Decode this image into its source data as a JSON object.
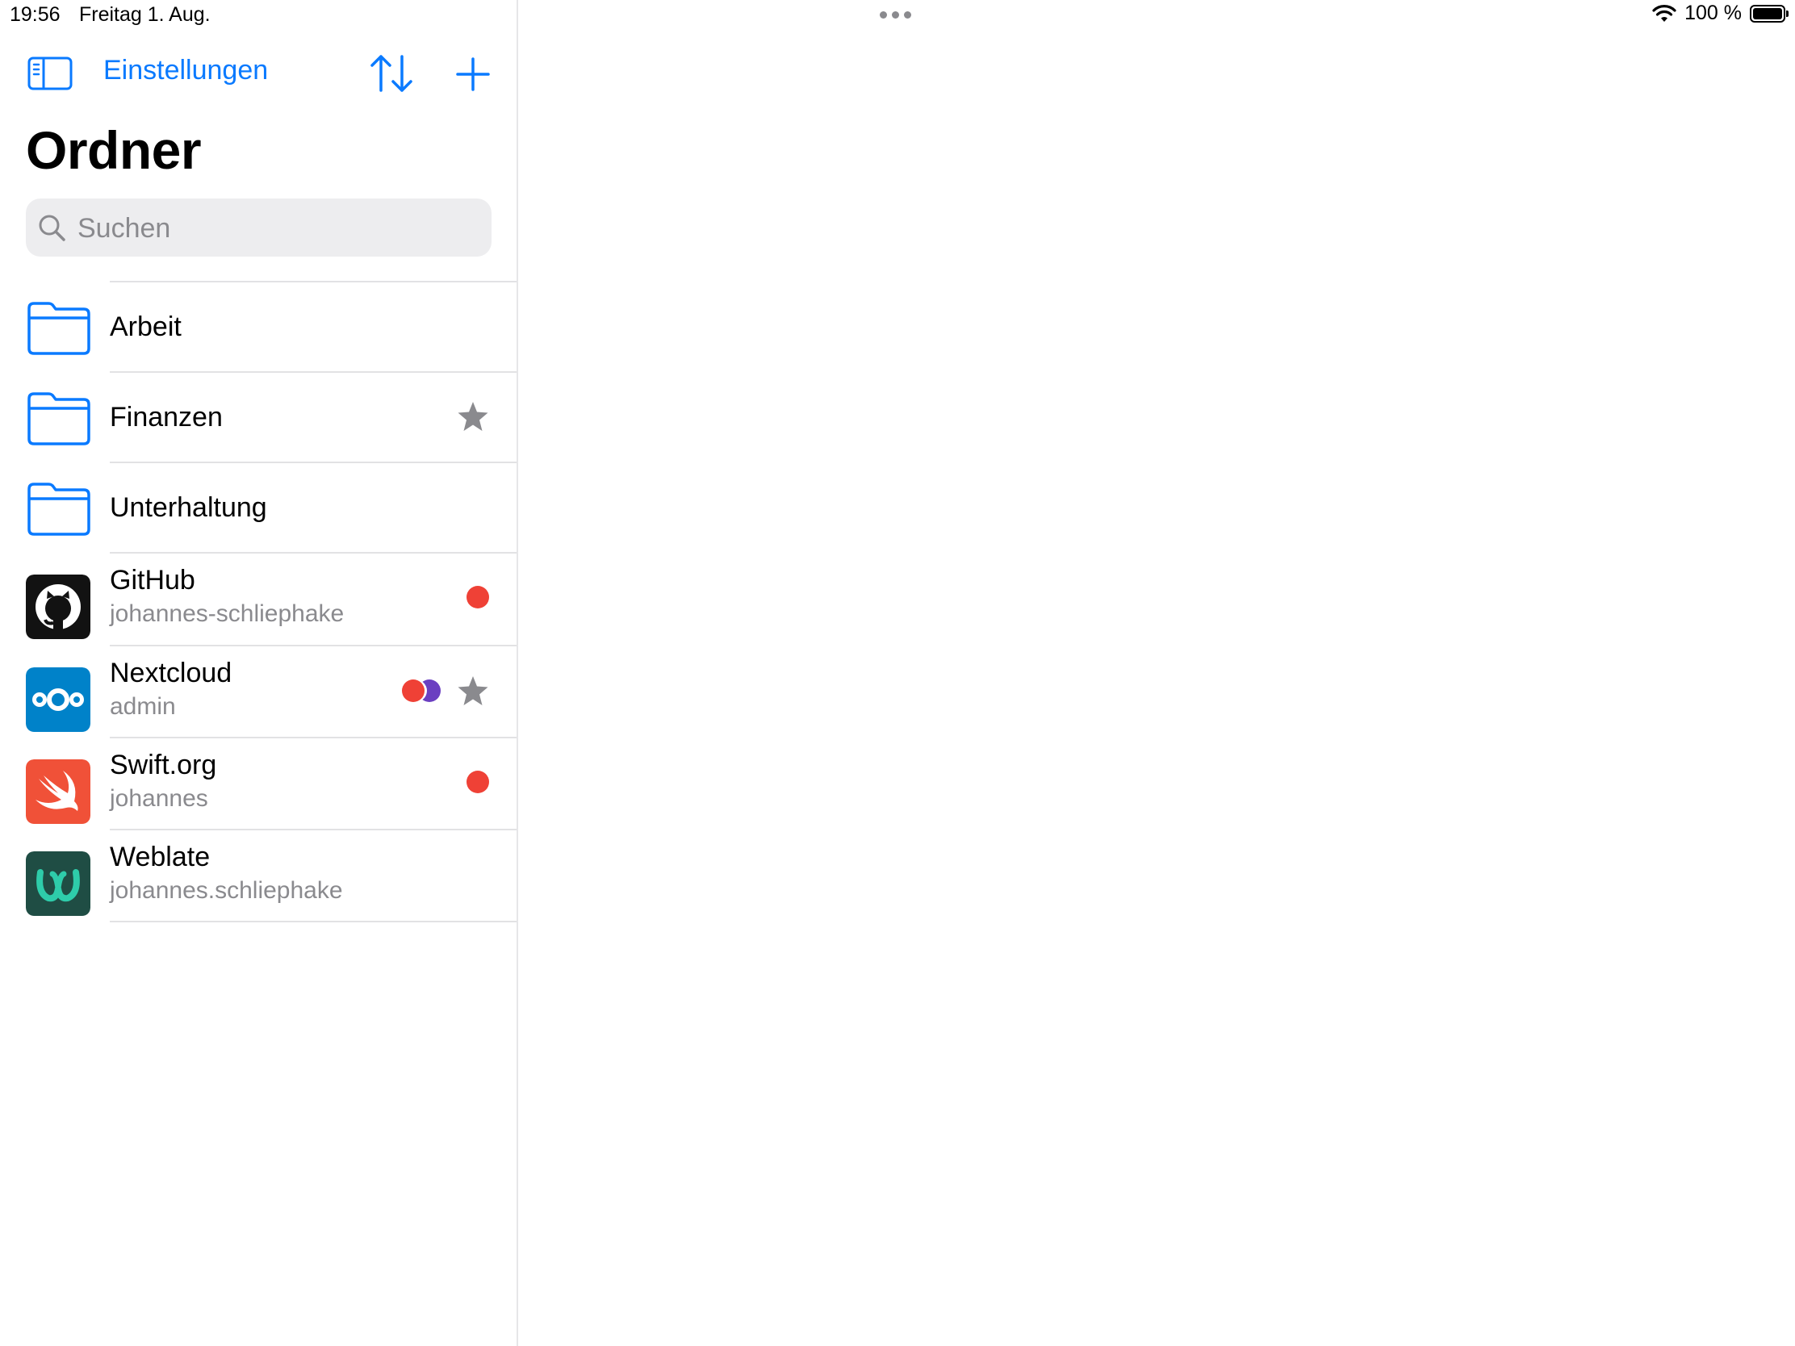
{
  "status_bar": {
    "time": "19:56",
    "date": "Freitag 1. Aug.",
    "battery": "100 %"
  },
  "toolbar": {
    "settings_label": "Einstellungen"
  },
  "page": {
    "title": "Ordner"
  },
  "search": {
    "placeholder": "Suchen"
  },
  "colors": {
    "accent": "#0a7aff",
    "tag_red": "#ef4136",
    "tag_purple": "#6b3fc1",
    "star_gray": "#8a8a8e"
  },
  "folders": [
    {
      "name": "Arbeit",
      "favorite": false
    },
    {
      "name": "Finanzen",
      "favorite": true
    },
    {
      "name": "Unterhaltung",
      "favorite": false
    }
  ],
  "entries": [
    {
      "title": "GitHub",
      "username": "johannes-schliephake",
      "icon": "github-icon",
      "tags": [
        "red"
      ],
      "favorite": false
    },
    {
      "title": "Nextcloud",
      "username": "admin",
      "icon": "nextcloud-icon",
      "tags": [
        "red",
        "purple"
      ],
      "favorite": true
    },
    {
      "title": "Swift.org",
      "username": "johannes",
      "icon": "swift-icon",
      "tags": [
        "red"
      ],
      "favorite": false
    },
    {
      "title": "Weblate",
      "username": "johannes.schliephake",
      "icon": "weblate-icon",
      "tags": [],
      "favorite": false
    }
  ]
}
